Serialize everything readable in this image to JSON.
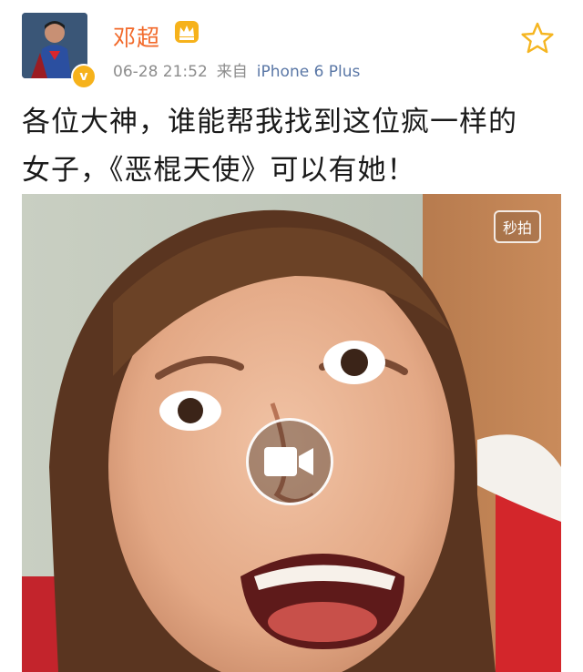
{
  "post": {
    "author": "邓超",
    "timestamp": "06-28 21:52",
    "source_prefix": "来自",
    "source": "iPhone 6 Plus",
    "text_line1": "各位大神，谁能帮我找到这位疯一样的",
    "text_line2": "女子，《恶棍天使》可以有她！"
  },
  "video": {
    "badge": "秒拍",
    "play_icon": "video-camera-icon"
  },
  "icons": {
    "avatar": "superhero-avatar",
    "verified": "verified-badge-icon",
    "crown": "crown-icon",
    "favorite": "star-icon"
  },
  "colors": {
    "username": "#f26a2b",
    "meta": "#8c8c8c",
    "link": "#5a77a6",
    "verified": "#f6b21b",
    "star": "#f5b520"
  }
}
